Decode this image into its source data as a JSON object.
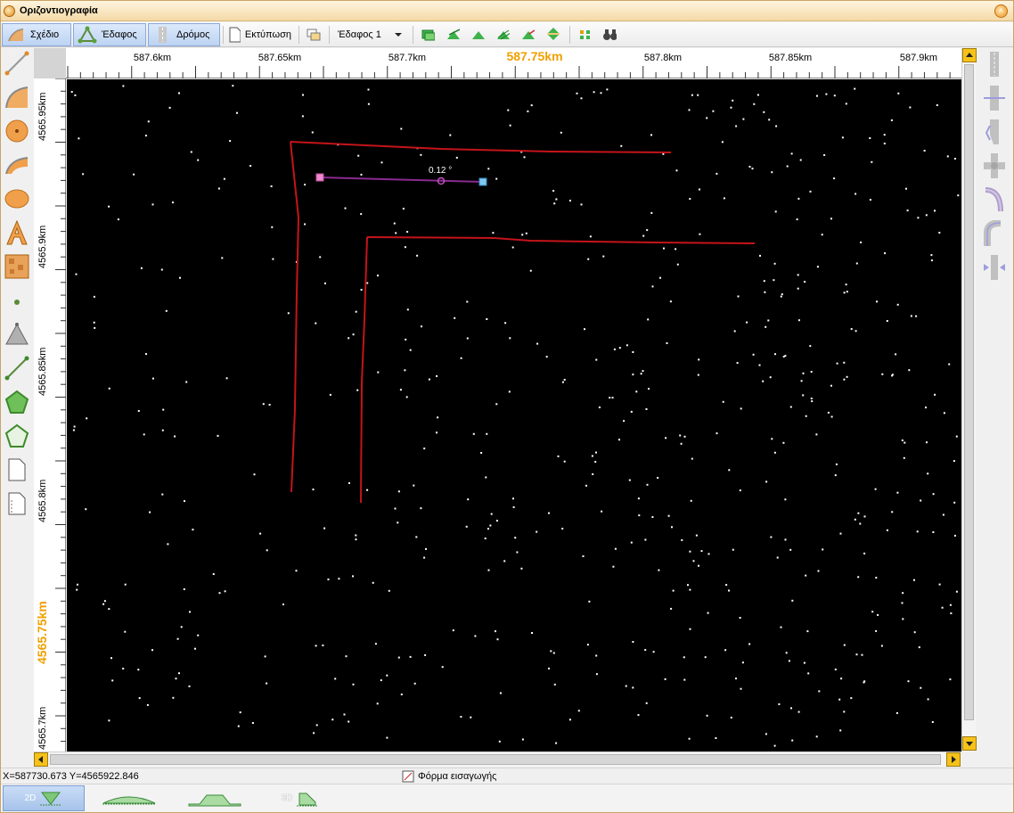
{
  "window": {
    "title": "Οριζοντιογραφία"
  },
  "toolbar": {
    "design_label": "Σχέδιο",
    "terrain_label": "Έδαφος",
    "road_label": "Δρόμος",
    "print_label": "Εκτύπωση",
    "terrain_select_value": "Έδαφος 1"
  },
  "ruler": {
    "x_labels": [
      "587.6km",
      "587.65km",
      "587.7km",
      "587.75km",
      "587.8km",
      "587.85km",
      "587.9km"
    ],
    "x_highlight": "587.75km",
    "y_labels": [
      "4565.95km",
      "4565.9km",
      "4565.85km",
      "4565.8km",
      "4565.75km",
      "4565.7km"
    ],
    "y_highlight": "4565.75km"
  },
  "map": {
    "measure_label": "0.12 °",
    "line_color": "#c4141a",
    "measure_line_color": "#8a2a90",
    "background": "#000000"
  },
  "status": {
    "coordinates": "X=587730.673  Y=4565922.846",
    "form_label": "Φόρμα εισαγωγής"
  },
  "view_tabs": {
    "tab_2d": "2D",
    "tab_3d": "3D"
  },
  "colors": {
    "accent": "#f6c21a",
    "ruler_highlight": "#f0a000",
    "selected_tab": "#bcd3f2"
  }
}
